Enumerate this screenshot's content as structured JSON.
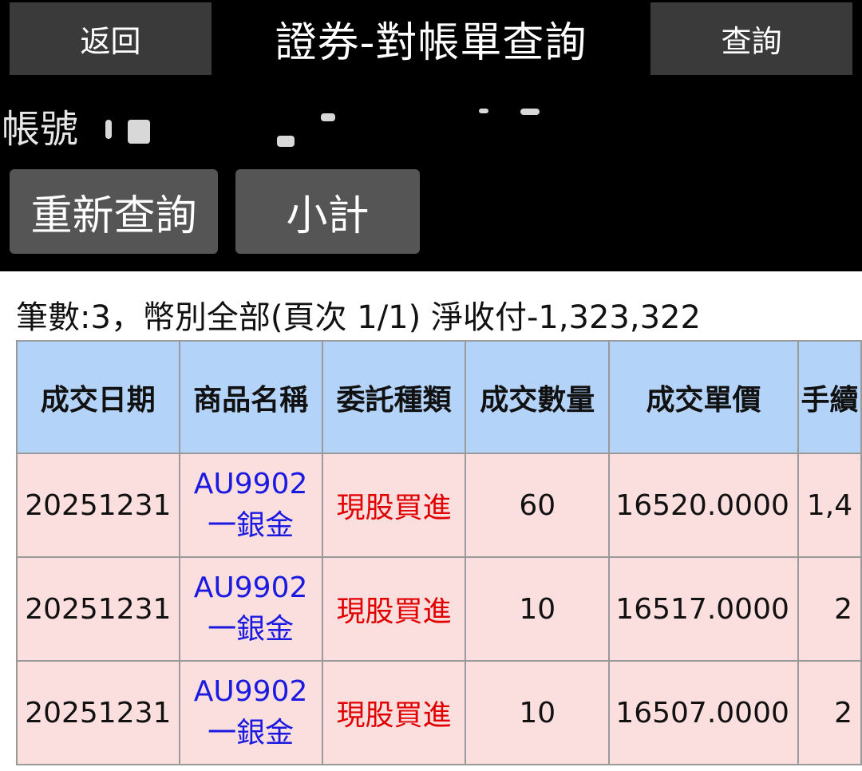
{
  "header": {
    "back_label": "返回",
    "title": "證券-對帳單查詢",
    "query_label": "查詢"
  },
  "account": {
    "label": "帳號"
  },
  "actions": {
    "requery_label": "重新查詢",
    "subtotal_label": "小計"
  },
  "summary": "筆數:3，幣別全部(頁次 1/1) 淨收付-1,323,322",
  "table": {
    "headers": [
      "成交日期",
      "商品名稱",
      "委託種類",
      "成交數量",
      "成交單價",
      "手續"
    ],
    "rows": [
      {
        "date": "20251231",
        "product_code": "AU9902",
        "product_name": "一銀金",
        "type": "現股買進",
        "qty": "60",
        "price": "16520.0000",
        "fee": "1,4"
      },
      {
        "date": "20251231",
        "product_code": "AU9902",
        "product_name": "一銀金",
        "type": "現股買進",
        "qty": "10",
        "price": "16517.0000",
        "fee": "2"
      },
      {
        "date": "20251231",
        "product_code": "AU9902",
        "product_name": "一銀金",
        "type": "現股買進",
        "qty": "10",
        "price": "16507.0000",
        "fee": "2"
      }
    ]
  },
  "colors": {
    "header_bg": "#000000",
    "button_bg": "#3a3a3a",
    "table_header_bg": "#b3d3f9",
    "row_bg": "#fbdede",
    "product_color": "#1a1ae0",
    "type_color": "#e10000"
  }
}
